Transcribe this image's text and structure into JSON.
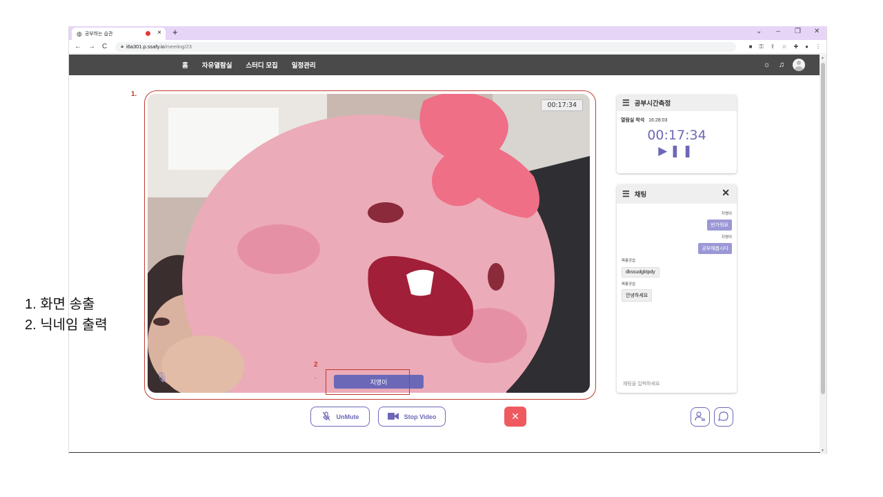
{
  "browser": {
    "tab_title": "공부하는 습관",
    "url_host": "i6a301.p.ssafy.io",
    "url_path": "/meeting/23",
    "new_tab": "+",
    "tab_close": "×"
  },
  "nav": {
    "items": [
      "홈",
      "자유열람실",
      "스터디 모집",
      "일정관리"
    ]
  },
  "video": {
    "elapsed": "00:17:34",
    "nickname": "지영이"
  },
  "controls": {
    "unmute": "UnMute",
    "stop_video": "Stop Video",
    "leave": "✕"
  },
  "time_panel": {
    "title": "공부시간측정",
    "enter_label": "열람실 착석",
    "enter_time": "16:28:03",
    "elapsed": "00:17:34",
    "play_pause": "▶❚❚"
  },
  "chat": {
    "title": "채팅",
    "close": "✕",
    "placeholder": "채팅을 입력하세요",
    "messages": [
      {
        "sender": "지영이",
        "text": "반가워요",
        "side": "right"
      },
      {
        "sender": "지영이",
        "text": "공부해봅시다",
        "side": "right"
      },
      {
        "sender": "짜릉공습",
        "text": "dkssudgktpdy",
        "side": "left"
      },
      {
        "sender": "짜릉공습",
        "text": "안녕하세요",
        "side": "left"
      }
    ]
  },
  "annotations": {
    "label1": "1.",
    "label2": "2",
    "label2_dot": "-",
    "note1": "1. 화면 송출",
    "note2": "2. 닉네임 출력"
  },
  "icons": {
    "menu": "menu-icon",
    "brightness": "sun-icon",
    "notification": "bell-icon"
  },
  "colors": {
    "accent": "#6c68b8",
    "leave": "#ef5a60",
    "navbar": "#4a4a4a",
    "annotation": "#c0392b",
    "tabbar": "#e6d5f7"
  }
}
